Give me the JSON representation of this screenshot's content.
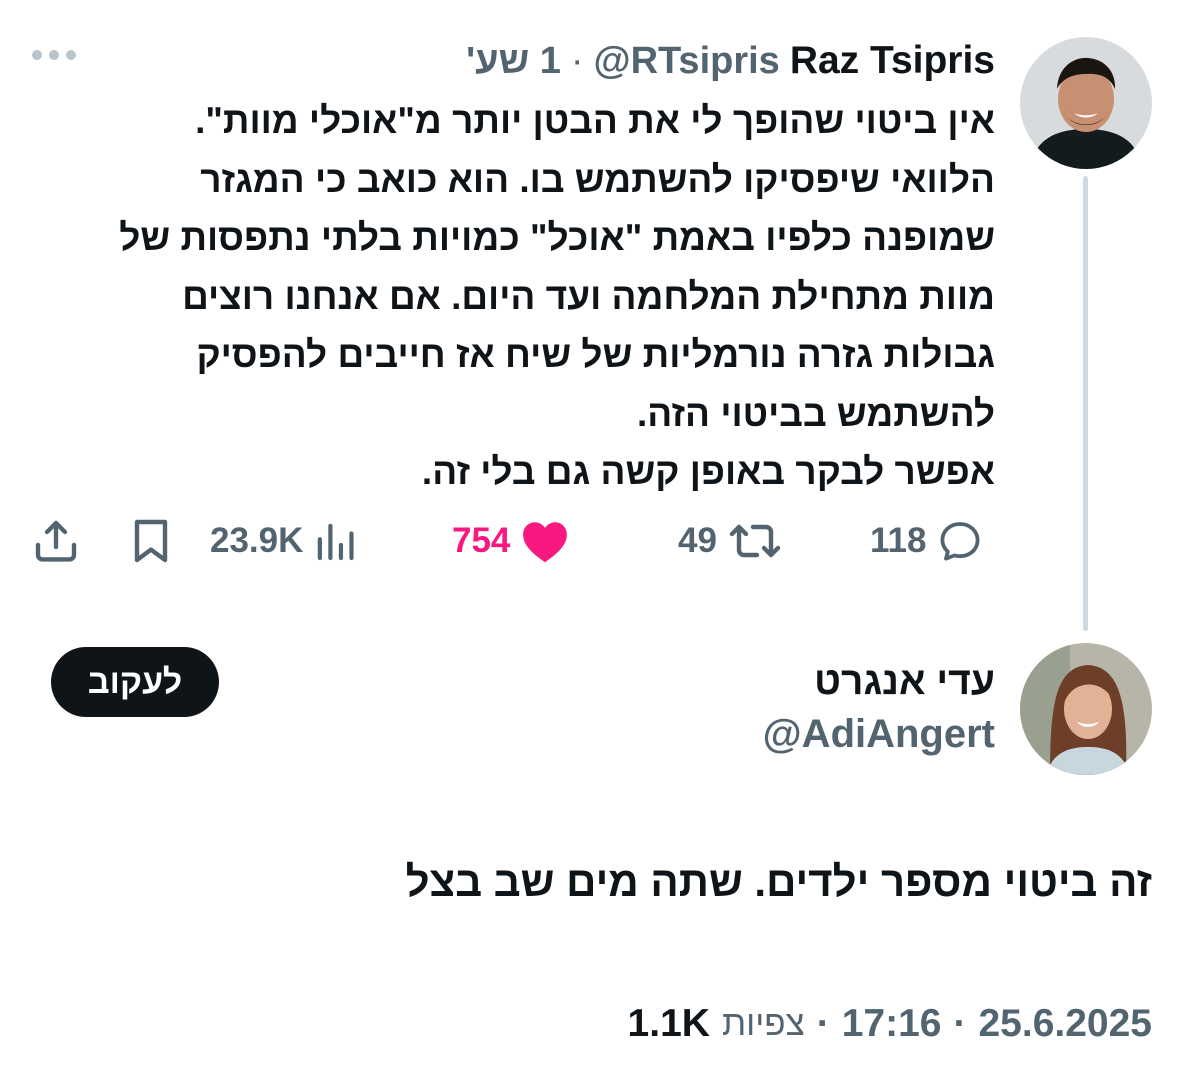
{
  "quoted_tweet": {
    "author_name": "Raz Tsipris",
    "handle": "@RTsipris",
    "separator": "·",
    "time_ago": "1 שע'",
    "text_lines": [
      "אין ביטוי שהופך לי את הבטן יותר מ\"אוכלי מוות\".",
      "הלוואי שיפסיקו להשתמש בו. הוא כואב כי המגזר",
      "שמופנה כלפיו באמת \"אוכל\" כמויות בלתי נתפסות של",
      "מוות מתחילת המלחמה ועד היום. אם אנחנו רוצים",
      "גבולות גזרה נורמליות של שיח אז חייבים להפסיק",
      "להשתמש בביטוי הזה.",
      "אפשר לבקר באופן קשה גם בלי זה."
    ],
    "actions": {
      "replies": "118",
      "reposts": "49",
      "likes": "754",
      "views": "23.9K"
    },
    "colors": {
      "like": "#f91880",
      "secondary_text": "#536471"
    }
  },
  "reply": {
    "author_name": "עדי אנגרט",
    "handle": "@AdiAngert",
    "follow_label": "לעקוב",
    "text": "זה ביטוי מספר ילדים. שתה מים שב בצל",
    "date": "25.6.2025",
    "time": "17:16",
    "separator": "·",
    "views_count": "1.1K",
    "views_label": "צפיות"
  },
  "icons": {
    "more": "more-dots-icon",
    "reply": "reply-bubble-icon",
    "repost": "repost-icon",
    "like": "heart-icon",
    "views": "views-bars-icon",
    "bookmark": "bookmark-icon",
    "share": "share-icon"
  }
}
